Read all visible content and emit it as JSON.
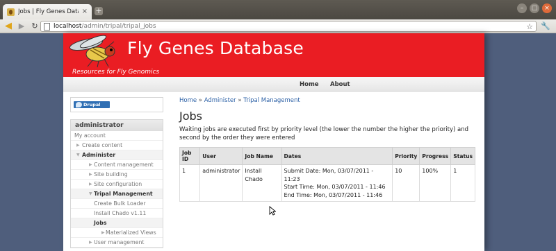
{
  "browser": {
    "tab_title": "Jobs | Fly Genes Data…",
    "tab_close": "×",
    "new_tab": "+",
    "url_host": "localhost",
    "url_path": "/admin/tripal/tripal_jobs",
    "icons": {
      "back": "back-arrow-icon",
      "forward": "forward-arrow-icon",
      "reload": "reload-icon",
      "star": "bookmark-star-icon",
      "wrench": "wrench-icon"
    }
  },
  "site": {
    "name": "Fly Genes Database",
    "slogan": "Resources for Fly Genomics",
    "banner_color": "#ea1d23"
  },
  "primary_nav": {
    "home": "Home",
    "about": "About"
  },
  "sidebar": {
    "drupal_badge": "Drupal",
    "user_block_title": "administrator",
    "menu": [
      {
        "label": "My account",
        "level": 0,
        "arrow": ""
      },
      {
        "label": "Create content",
        "level": 1,
        "arrow": "▶"
      },
      {
        "label": "Administer",
        "level": 1,
        "arrow": "▼",
        "bold": true
      },
      {
        "label": "Content management",
        "level": 2,
        "arrow": "▶"
      },
      {
        "label": "Site building",
        "level": 2,
        "arrow": "▶"
      },
      {
        "label": "Site configuration",
        "level": 2,
        "arrow": "▶"
      },
      {
        "label": "Tripal Management",
        "level": 2,
        "arrow": "▼",
        "bold": true
      },
      {
        "label": "Create Bulk Loader",
        "level": 3,
        "arrow": ""
      },
      {
        "label": "Install Chado v1.11",
        "level": 3,
        "arrow": ""
      },
      {
        "label": "Jobs",
        "level": 3,
        "arrow": "",
        "bold": true
      },
      {
        "label": "Materialized Views",
        "level": 4,
        "arrow": "▶"
      },
      {
        "label": "User management",
        "level": 2,
        "arrow": "▶"
      }
    ]
  },
  "main": {
    "breadcrumb": [
      "Home",
      "Administer",
      "Tripal Management"
    ],
    "breadcrumb_sep": " » ",
    "title": "Jobs",
    "description": "Waiting jobs are executed first by priority level (the lower the number the higher the priority) and second by the order they were entered",
    "table": {
      "headers": [
        "Job ID",
        "User",
        "Job Name",
        "Dates",
        "Priority",
        "Progress",
        "Status"
      ],
      "rows": [
        {
          "job_id": "1",
          "user": "administrator",
          "job_name": "Install Chado",
          "submit": "Submit Date: Mon, 03/07/2011 - 11:23",
          "start": "Start Time: Mon, 03/07/2011 - 11:46",
          "end": "End Time: Mon, 03/07/2011 - 11:46",
          "priority": "10",
          "progress": "100%",
          "status": "1"
        }
      ]
    }
  }
}
